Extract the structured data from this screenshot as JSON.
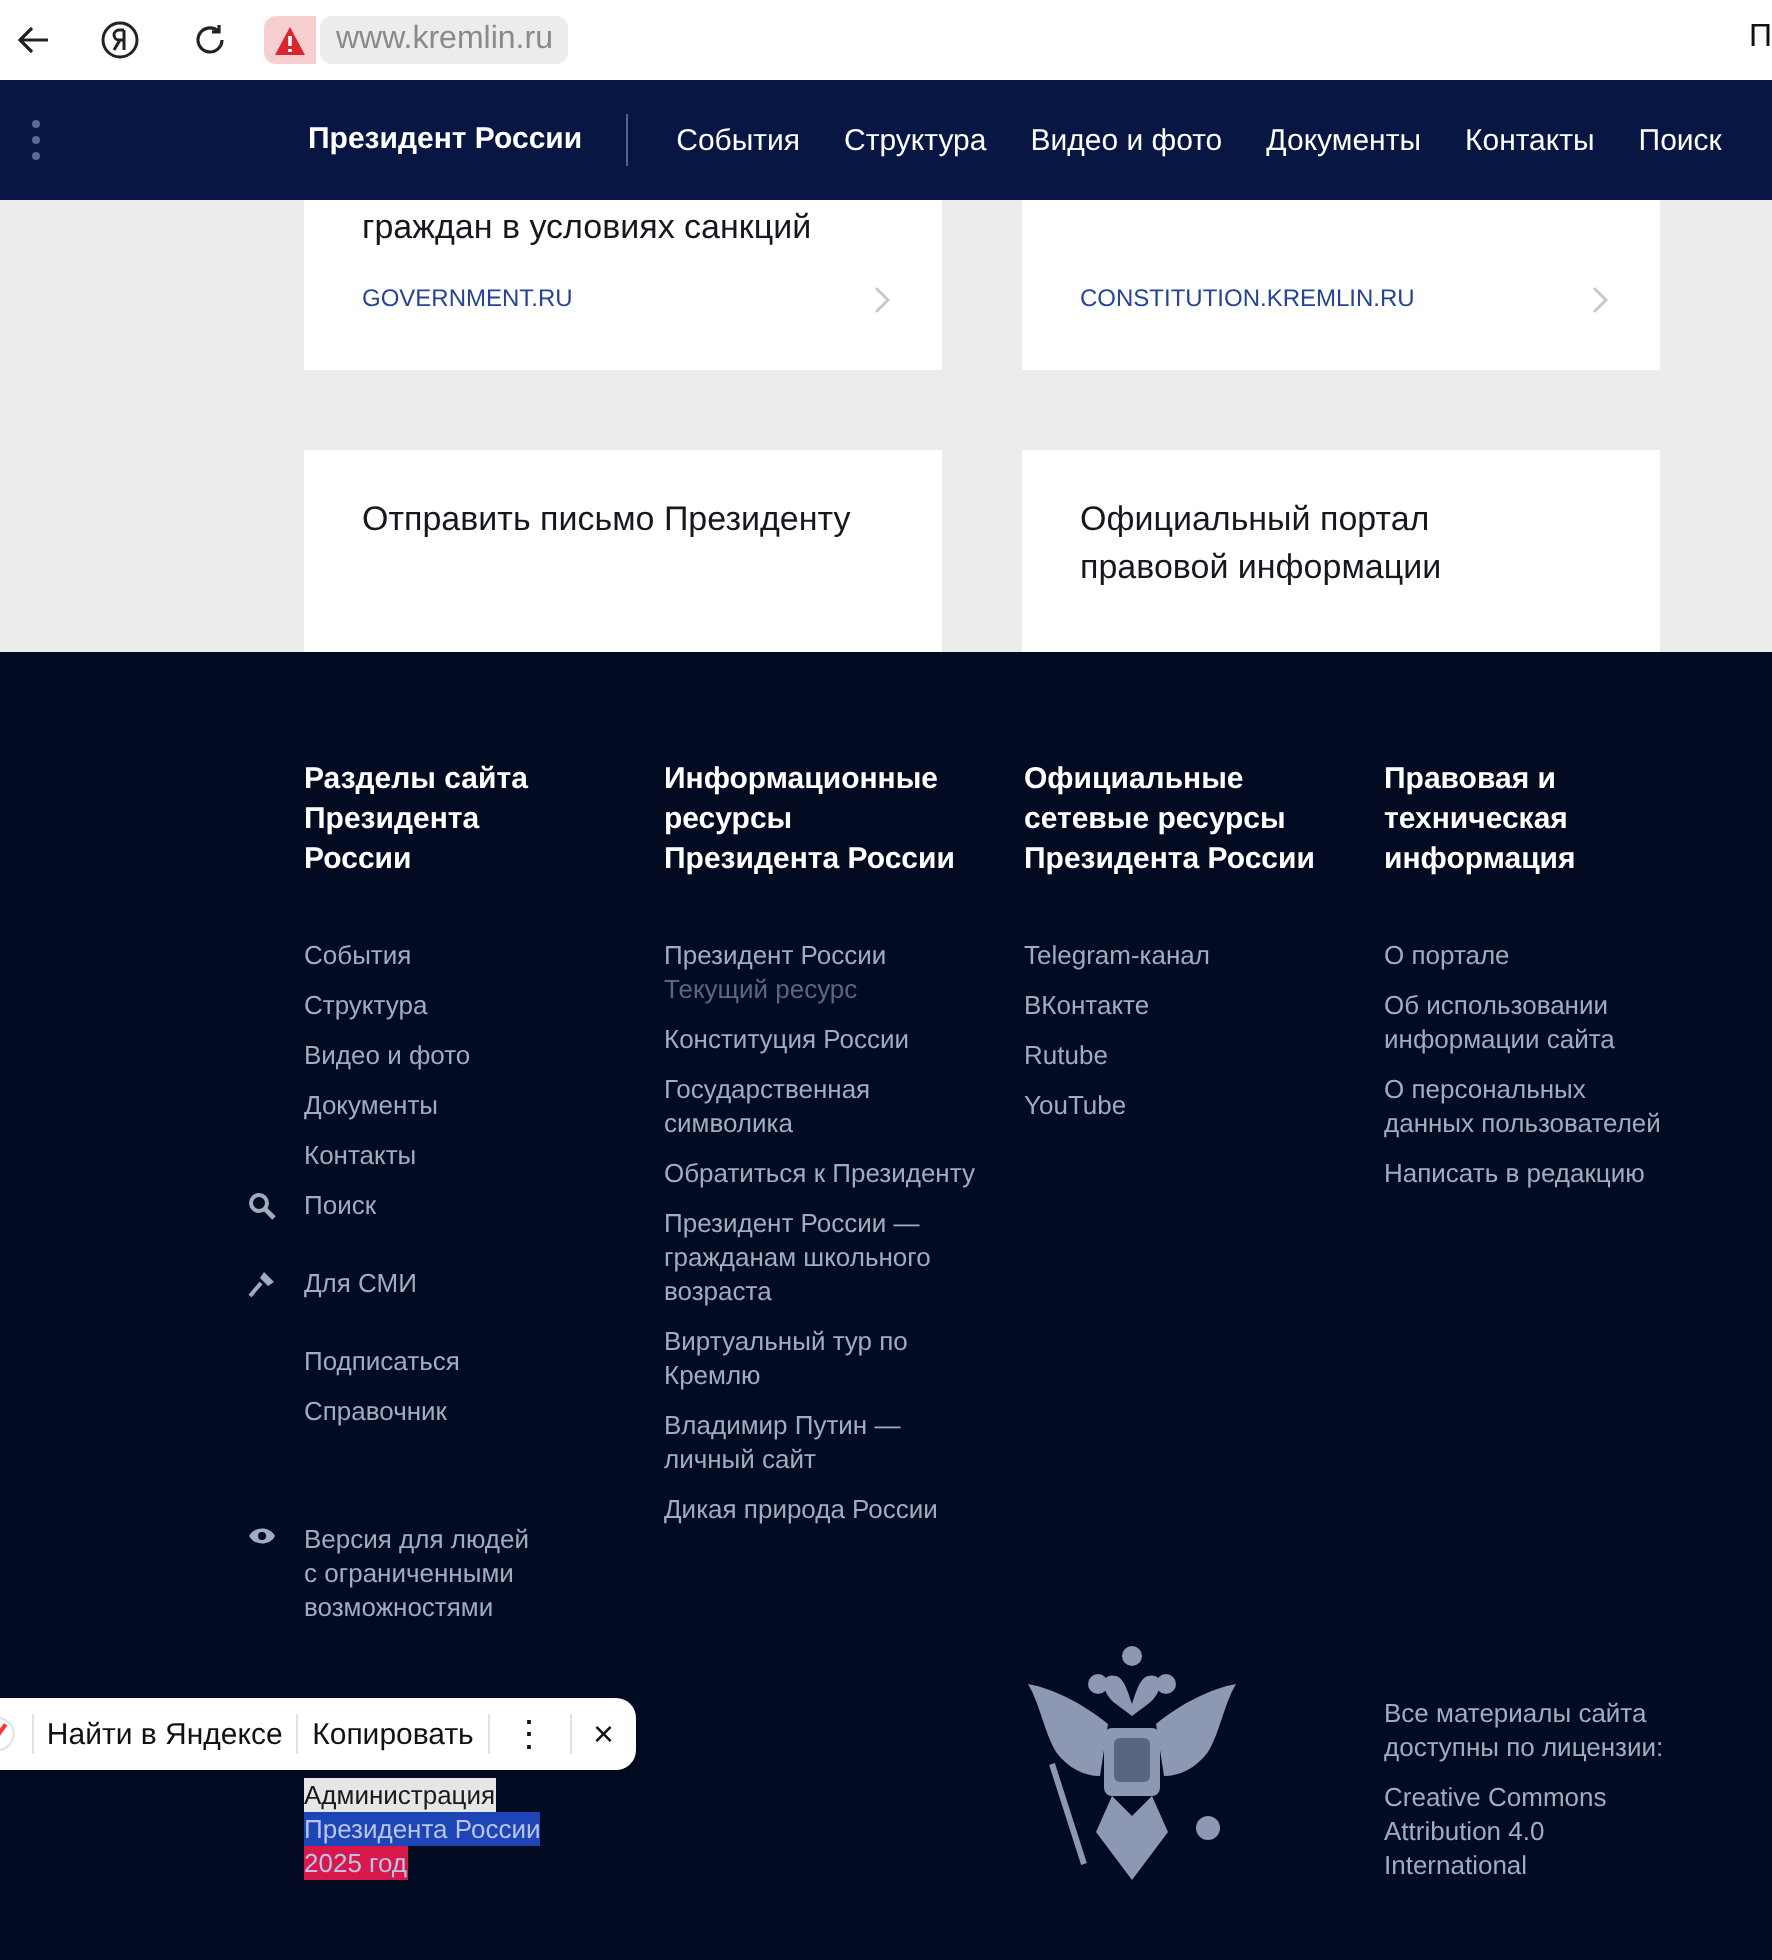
{
  "browser": {
    "url": "www.kremlin.ru",
    "edge_text": "П"
  },
  "nav": {
    "brand": "Президент России",
    "items": [
      "События",
      "Структура",
      "Видео и фото",
      "Документы",
      "Контакты",
      "Поиск"
    ]
  },
  "cards": [
    {
      "title": "граждан в условиях санкций",
      "link": "GOVERNMENT.RU"
    },
    {
      "link": "CONSTITUTION.KREMLIN.RU"
    },
    {
      "title": "Отправить письмо Президенту"
    },
    {
      "title": "Официальный портал\nправовой информации"
    }
  ],
  "footer": {
    "columns": [
      {
        "heading": "Разделы сайта\nПрезидента\nРоссии",
        "groups": [
          [
            {
              "kind": "link",
              "text": "События"
            },
            {
              "kind": "link",
              "text": "Структура"
            },
            {
              "kind": "link",
              "text": "Видео и фото"
            },
            {
              "kind": "link",
              "text": "Документы"
            },
            {
              "kind": "link",
              "text": "Контакты"
            },
            {
              "kind": "search",
              "text": "Поиск"
            }
          ],
          [
            {
              "kind": "press",
              "text": "Для СМИ"
            }
          ],
          [
            {
              "kind": "link",
              "text": "Подписаться"
            },
            {
              "kind": "link",
              "text": "Справочник"
            }
          ],
          [
            {
              "kind": "accessibility",
              "text": "Версия для людей\nс ограниченными\nвозможностями"
            }
          ]
        ]
      },
      {
        "heading": "Информационные\nресурсы\nПрезидента России",
        "groups": [
          [
            {
              "kind": "link",
              "text": "Президент России",
              "note": "Текущий ресурс"
            },
            {
              "kind": "link",
              "text": "Конституция России"
            },
            {
              "kind": "link",
              "text": "Государственная\nсимволика"
            },
            {
              "kind": "link",
              "text": "Обратиться к Президенту"
            },
            {
              "kind": "link",
              "text": "Президент России —\nгражданам школьного\nвозраста"
            },
            {
              "kind": "link",
              "text": "Виртуальный тур по\nКремлю"
            },
            {
              "kind": "link",
              "text": "Владимир Путин —\nличный сайт"
            },
            {
              "kind": "link",
              "text": "Дикая природа России"
            }
          ]
        ]
      },
      {
        "heading": "Официальные\nсетевые ресурсы\nПрезидента России",
        "groups": [
          [
            {
              "kind": "link",
              "text": "Telegram-канал"
            },
            {
              "kind": "link",
              "text": "ВКонтакте"
            },
            {
              "kind": "link",
              "text": "Rutube"
            },
            {
              "kind": "link",
              "text": "YouTube"
            }
          ]
        ]
      },
      {
        "heading": "Правовая и\nтехническая\nинформация",
        "groups": [
          [
            {
              "kind": "link",
              "text": "О портале"
            },
            {
              "kind": "link",
              "text": "Об использовании\nинформации сайта"
            },
            {
              "kind": "link",
              "text": "О персональных\nданных пользователей"
            },
            {
              "kind": "link",
              "text": "Написать в редакцию"
            }
          ]
        ]
      }
    ],
    "copyright": [
      {
        "text": "Администрация",
        "color": "#e6e6e6"
      },
      {
        "text": "Президента России",
        "color": "#1d45b5"
      },
      {
        "text": "2025 год",
        "color": "#d8174a"
      }
    ],
    "license_note": "Все материалы сайта\nдоступны по лицензии:",
    "license_link": "Creative Commons\nAttribution 4.0\nInternational"
  },
  "selection_popup": {
    "items": [
      "Найти в Яндексе",
      "Копировать"
    ],
    "more": "⋮",
    "close": "×"
  }
}
